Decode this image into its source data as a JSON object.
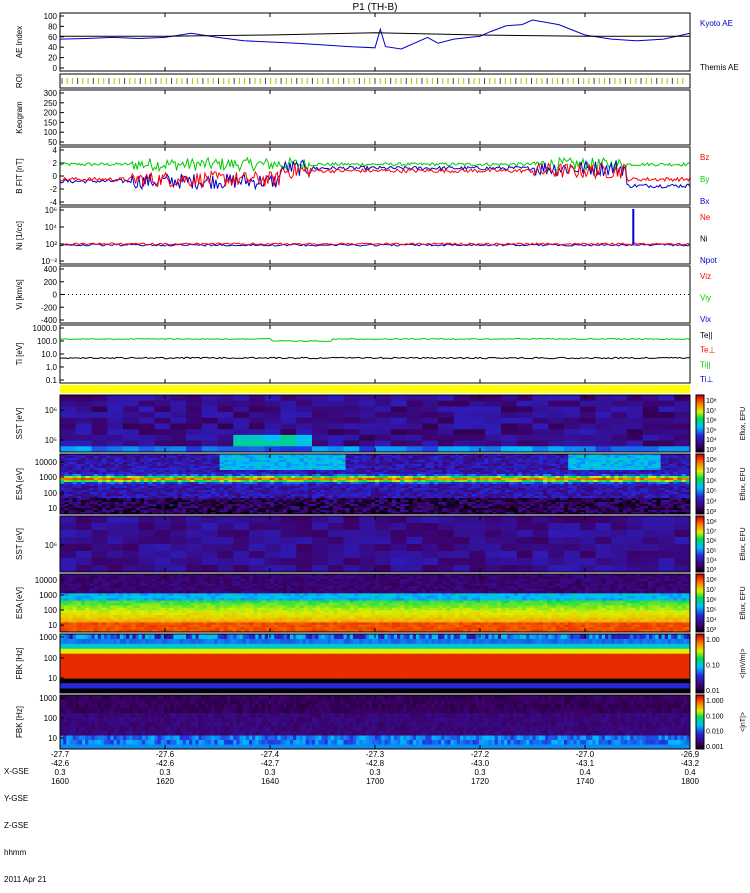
{
  "title": "P1 (TH-B)",
  "colors": {
    "kyoto": "#0000cc",
    "themis": "#000000",
    "red": "#ff0000",
    "green": "#00cc00",
    "blue": "#0000cc",
    "roi_bar": "#ffff00",
    "plot_bg": "#ffffff",
    "spec_bg": "#000000"
  },
  "panels": {
    "ae": {
      "ylabel": "AE Index",
      "ticks": [
        "100",
        "80",
        "60",
        "40",
        "20",
        "0"
      ],
      "legend": [
        "Kyoto AE",
        "Themis AE"
      ]
    },
    "roi": {
      "ylabel": "ROI"
    },
    "keogram": {
      "ylabel": "Keogram",
      "ticks": [
        "300",
        "250",
        "200",
        "150",
        "100",
        "50"
      ]
    },
    "bfield": {
      "ylabel": "B FIT [nT]",
      "ticks": [
        "4",
        "2",
        "0",
        "-2",
        "-4"
      ],
      "legend": [
        "Bz",
        "By",
        "Bx"
      ]
    },
    "density": {
      "ylabel": "Ni [1/cc]",
      "ticks": [
        "10⁶",
        "10⁴",
        "10²",
        "10⁻²"
      ],
      "legend": [
        "Ne",
        "Ni",
        "Npot"
      ]
    },
    "velocity": {
      "ylabel": "Vi [km/s]",
      "ticks": [
        "400",
        "200",
        "0",
        "-200",
        "-400"
      ],
      "legend": [
        "Viz",
        "Viy",
        "Vix"
      ]
    },
    "temperature": {
      "ylabel": "Ti [eV]",
      "ticks": [
        "1000.0",
        "100.0",
        "10.0",
        "1.0",
        "0.1"
      ],
      "legend": [
        "Te||",
        "Te⊥",
        "Ti||",
        "Ti⊥"
      ]
    },
    "sst1": {
      "ylabel": "SST [eV]",
      "ticks": [
        "10⁶",
        "10⁵"
      ]
    },
    "esa1": {
      "ylabel": "ESA [eV]",
      "ticks": [
        "10000",
        "1000",
        "100",
        "10"
      ]
    },
    "sst2": {
      "ylabel": "SST [eV]",
      "ticks": [
        "10⁶"
      ]
    },
    "esa2": {
      "ylabel": "ESA [eV]",
      "ticks": [
        "10000",
        "1000",
        "100",
        "10"
      ]
    },
    "fbk1": {
      "ylabel": "FBK [Hz]",
      "ticks": [
        "1000",
        "100",
        "10"
      ]
    },
    "fbk2": {
      "ylabel": "FBK [Hz]",
      "ticks": [
        "1000",
        "100",
        "10"
      ]
    }
  },
  "colorbars": {
    "cb1": {
      "label": "Eflux, EFU",
      "ticks": [
        "10⁸",
        "10⁷",
        "10⁶",
        "10⁵",
        "10⁴",
        "10³"
      ]
    },
    "cb2": {
      "label": "Eflux, EFU",
      "ticks": [
        "10⁸",
        "10⁷",
        "10⁶",
        "10⁵",
        "10⁴",
        "10³"
      ]
    },
    "cb3": {
      "label": "Eflux, EFU",
      "ticks": [
        "10⁸",
        "10⁷",
        "10⁶",
        "10⁵",
        "10⁴",
        "10³"
      ]
    },
    "cb4": {
      "label": "Eflux, EFU",
      "ticks": [
        "10⁸",
        "10⁷",
        "10⁶",
        "10⁵",
        "10⁴",
        "10³"
      ]
    },
    "cb5": {
      "label": "<|mV/m|>",
      "ticks": [
        "1.00",
        "0.10",
        "0.01"
      ]
    },
    "cb6": {
      "label": "<|nT|>",
      "ticks": [
        "1.000",
        "0.100",
        "0.010",
        "0.001"
      ]
    }
  },
  "chart_data": {
    "type": "line",
    "title": "P1 (TH-B)",
    "x_range": [
      "1600",
      "1800"
    ],
    "xaxis": {
      "rows": [
        {
          "label": "X-GSE",
          "values": [
            "-27.7",
            "-27.6",
            "-27.4",
            "-27.3",
            "-27.2",
            "-27.0",
            "-26.9"
          ]
        },
        {
          "label": "Y-GSE",
          "values": [
            "-42.6",
            "-42.6",
            "-42.7",
            "-42.8",
            "-43.0",
            "-43.1",
            "-43.2"
          ]
        },
        {
          "label": "Z-GSE",
          "values": [
            "0.3",
            "0.3",
            "0.3",
            "0.3",
            "0.3",
            "0.4",
            "0.4"
          ]
        },
        {
          "label": "hhmm",
          "values": [
            "1600",
            "1620",
            "1640",
            "1700",
            "1720",
            "1740",
            "1800"
          ]
        }
      ],
      "date": "2011 Apr 21"
    },
    "series": [
      {
        "name": "Kyoto AE",
        "x": [
          1600,
          1605,
          1610,
          1615,
          1620,
          1625,
          1630,
          1635,
          1640,
          1645,
          1650,
          1655,
          1700,
          1701,
          1702,
          1705,
          1710,
          1712,
          1715,
          1720,
          1722,
          1725,
          1728,
          1730,
          1735,
          1740,
          1745,
          1750,
          1755,
          1800
        ],
        "y": [
          55,
          56,
          58,
          56,
          58,
          65,
          58,
          52,
          50,
          48,
          45,
          42,
          40,
          72,
          42,
          38,
          58,
          48,
          55,
          60,
          68,
          78,
          80,
          88,
          80,
          62,
          55,
          52,
          55,
          65
        ]
      },
      {
        "name": "Themis AE",
        "x": [
          1600,
          1620,
          1640,
          1700,
          1720,
          1740,
          1800
        ],
        "y": [
          60,
          60,
          62,
          66,
          62,
          60,
          60
        ]
      }
    ]
  }
}
